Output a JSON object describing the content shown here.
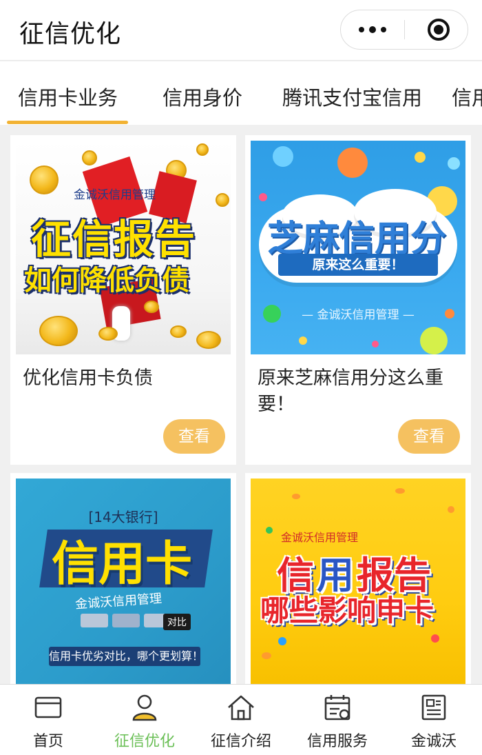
{
  "header": {
    "title": "征信优化"
  },
  "tabs": [
    {
      "label": "信用卡业务"
    },
    {
      "label": "信用身价"
    },
    {
      "label": "腾讯支付宝信用"
    },
    {
      "label": "信用"
    }
  ],
  "cards": [
    {
      "title": "优化信用卡负债",
      "button": "查看",
      "art": {
        "brand": "金诚沃信用管理",
        "line1": "征信报告",
        "line2": "如何降低负债"
      }
    },
    {
      "title": "原来芝麻信用分这么重要！",
      "button": "查看",
      "art": {
        "headline": "芝麻信用分",
        "ribbon": "原来这么重要！",
        "brand": "— 金诚沃信用管理 —"
      }
    },
    {
      "title": "",
      "button": "",
      "art": {
        "top": "[14大银行]",
        "headline": "信用卡",
        "brand": "金诚沃信用管理",
        "tag": "对比",
        "bar": "信用卡优劣对比，哪个更划算！"
      }
    },
    {
      "title": "",
      "button": "",
      "art": {
        "brand": "金诚沃信用管理",
        "line1a": "信",
        "line1b": "用",
        "line1c": "报告",
        "line2": "哪些影响申卡"
      }
    }
  ],
  "nav": [
    {
      "label": "首页",
      "icon": "card-icon"
    },
    {
      "label": "征信优化",
      "icon": "user-icon",
      "active": true
    },
    {
      "label": "征信介绍",
      "icon": "home-icon"
    },
    {
      "label": "信用服务",
      "icon": "calendar-icon"
    },
    {
      "label": "金诚沃",
      "icon": "newspaper-icon"
    }
  ],
  "colors": {
    "accent": "#f2b233",
    "button": "#f5c160",
    "nav_active": "#6abf56"
  }
}
